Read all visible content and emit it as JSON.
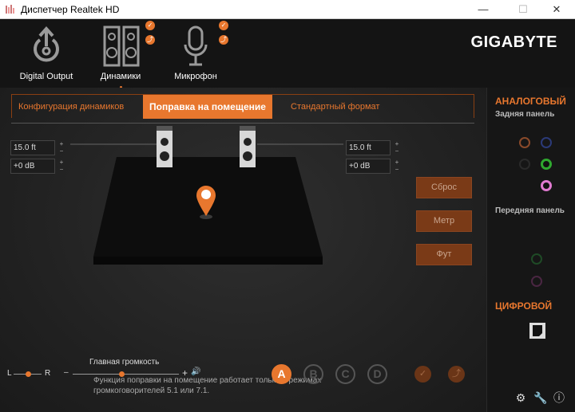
{
  "window": {
    "title": "Диспетчер Realtek HD",
    "minimize": "—",
    "maximize": "☐",
    "close": "✕"
  },
  "devices": [
    {
      "label": "Digital Output"
    },
    {
      "label": "Динамики",
      "active": true
    },
    {
      "label": "Микрофон"
    }
  ],
  "brand": "GIGABYTE",
  "tabs": [
    "Конфигурация динамиков",
    "Поправка на помещение",
    "Стандартный формат"
  ],
  "active_tab": 1,
  "left_distance": "15.0 ft",
  "left_gain": "+0 dB",
  "right_distance": "15.0 ft",
  "right_gain": "+0 dB",
  "buttons": {
    "reset": "Сброс",
    "meter": "Метр",
    "foot": "Фут"
  },
  "note": "Функция поправки на помещение работает только в режимах громкоговорителей 5.1 или 7.1.",
  "volume": {
    "title": "Главная громкость",
    "balance_left": "L",
    "balance_right": "R",
    "balance_level": 0.5,
    "main_level": 0.46,
    "plus": "+",
    "speaker": "🔊"
  },
  "profiles": [
    "A",
    "B",
    "C",
    "D"
  ],
  "active_profile": "A",
  "side": {
    "analog": "АНАЛОГОВЫЙ",
    "back_panel": "Задняя панель",
    "front_panel": "Передняя панель",
    "digital": "ЦИФРОВОЙ"
  },
  "jack_colors": {
    "orange": "#8a4a2a",
    "blue": "#2b3a78",
    "black": "#2a2a2a",
    "green": "#2fa82f",
    "pink": "#e07ad0",
    "front_green": "#1f4a26",
    "front_pink": "#4a2642"
  },
  "accent": "#e8772e",
  "spin_up": "+",
  "spin_down": "−"
}
